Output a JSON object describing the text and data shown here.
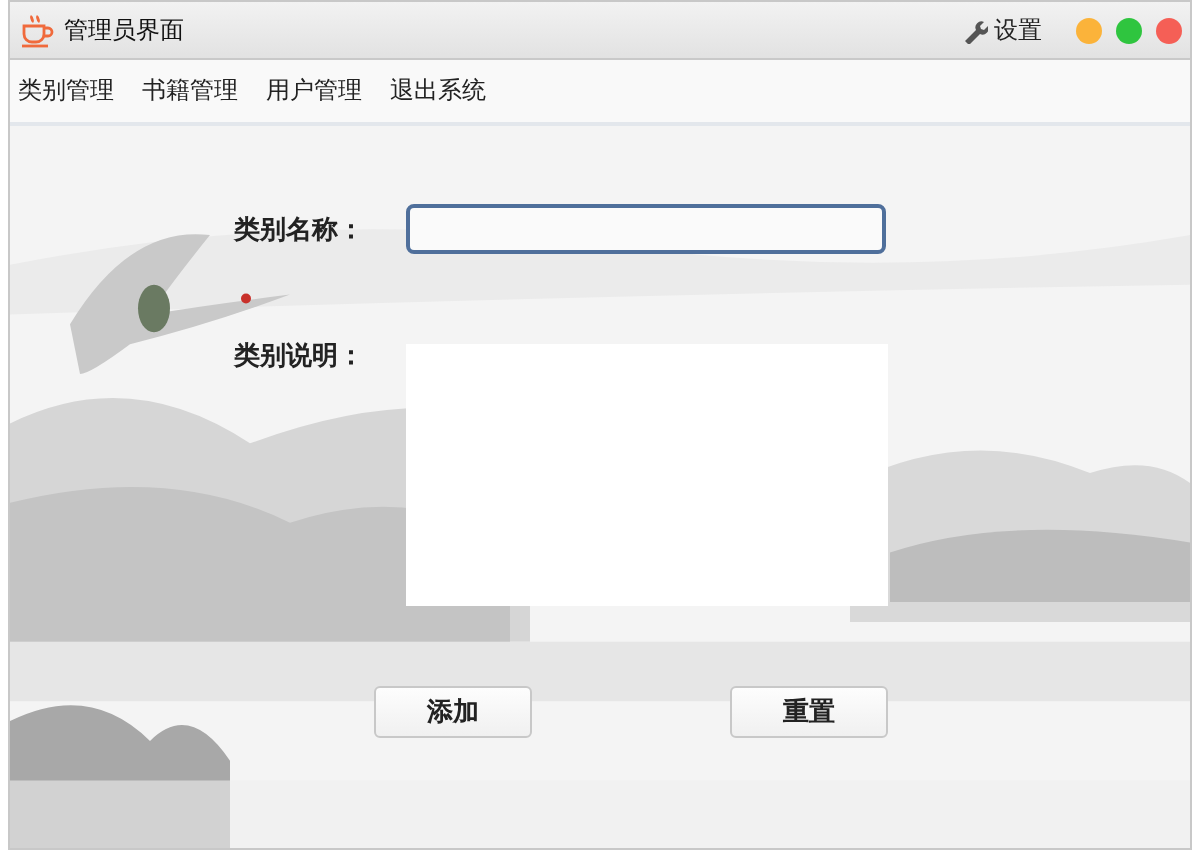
{
  "window": {
    "title": "管理员界面",
    "settings": "设置"
  },
  "menu": [
    {
      "label": "类别管理"
    },
    {
      "label": "书籍管理"
    },
    {
      "label": "用户管理"
    },
    {
      "label": "退出系统"
    }
  ],
  "form": {
    "name_label": "类别名称：",
    "description_label": "类别说明："
  },
  "buttons": [
    {
      "label": "添加"
    },
    {
      "label": "重置"
    }
  ]
}
